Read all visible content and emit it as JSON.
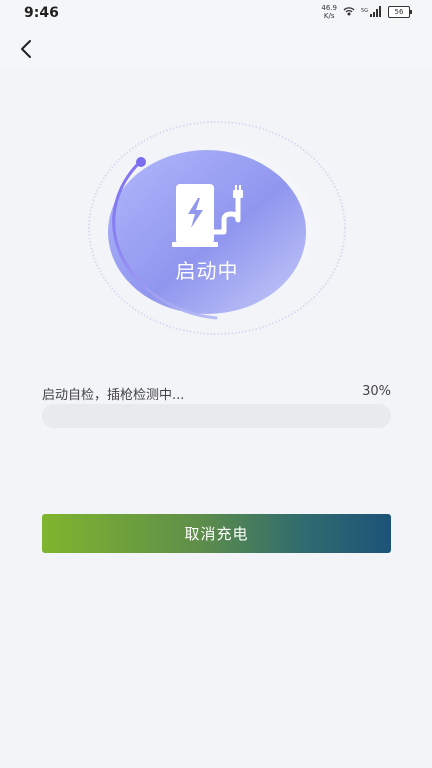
{
  "status_bar": {
    "time": "9:46",
    "net_speed_value": "46.9",
    "net_speed_unit": "K/s",
    "battery": "56"
  },
  "nav": {
    "back_icon": "chevron-left-icon"
  },
  "charging": {
    "status_label": "启动中",
    "icon": "charging-station-icon",
    "progress_text": "启动自检，插枪检测中...",
    "progress_percent_label": "30%",
    "progress": 0.3
  },
  "actions": {
    "cancel_label": "取消充电"
  },
  "colors": {
    "background": "#f3f4f7",
    "orb_start": "#a8b0f8",
    "orb_end": "#8a8fe8",
    "arc": "#7a6cf0",
    "button_start": "#7fb52e",
    "button_end": "#1c5379"
  }
}
